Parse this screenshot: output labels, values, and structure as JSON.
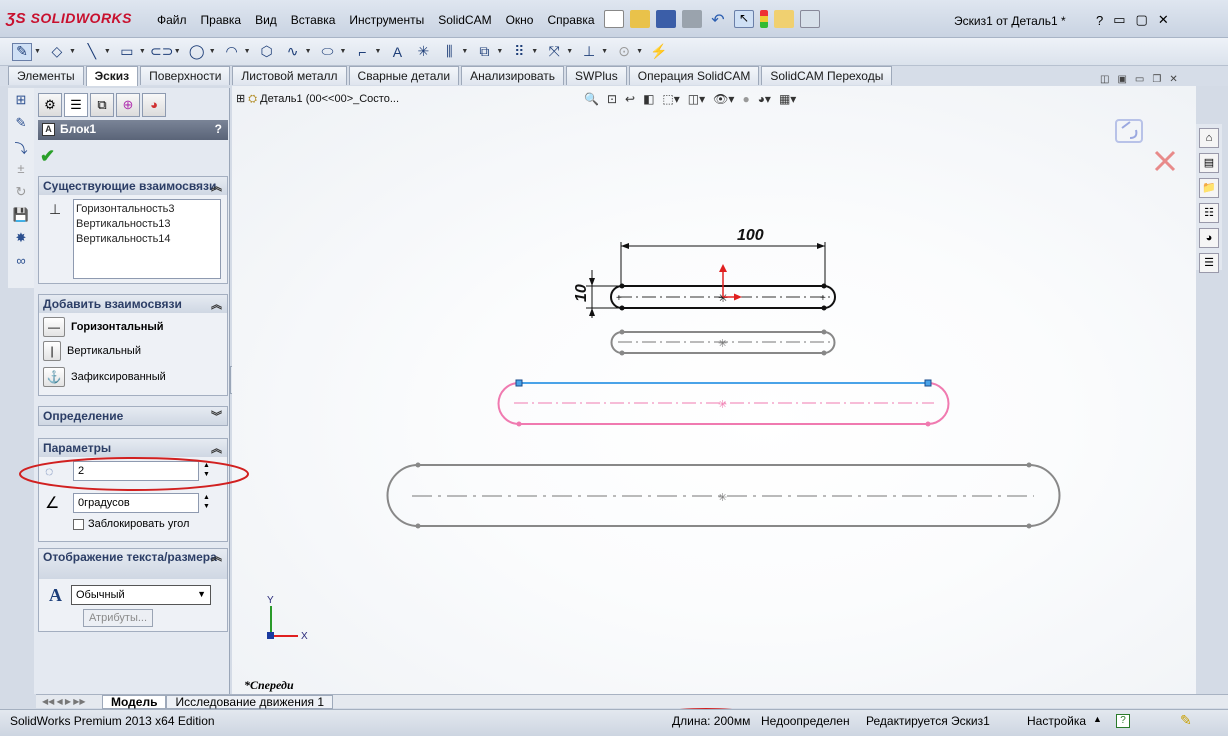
{
  "app": {
    "logo": "SOLIDWORKS",
    "document_title": "Эскиз1 от Деталь1 *"
  },
  "menu": [
    "Файл",
    "Правка",
    "Вид",
    "Вставка",
    "Инструменты",
    "SolidCAM",
    "Окно",
    "Справка"
  ],
  "command_tabs": [
    {
      "label": "Элементы",
      "active": false
    },
    {
      "label": "Эскиз",
      "active": true
    },
    {
      "label": "Поверхности",
      "active": false
    },
    {
      "label": "Листовой металл",
      "active": false
    },
    {
      "label": "Сварные детали",
      "active": false
    },
    {
      "label": "Анализировать",
      "active": false
    },
    {
      "label": "SWPlus",
      "active": false
    },
    {
      "label": "Операция  SolidCAM",
      "active": false
    },
    {
      "label": "SolidCAM Переходы",
      "active": false
    }
  ],
  "property_manager": {
    "title": "Блок1",
    "help": "?",
    "existing_relations": {
      "header": "Существующие взаимосвязи",
      "items": [
        "Горизонтальность3",
        "Вертикальность13",
        "Вертикальность14"
      ]
    },
    "add_relations": {
      "header": "Добавить взаимосвязи",
      "items": [
        {
          "label": "Горизонтальный",
          "bold": true
        },
        {
          "label": "Вертикальный",
          "bold": false
        },
        {
          "label": "Зафиксированный",
          "bold": false
        }
      ]
    },
    "definition": {
      "header": "Определение"
    },
    "parameters": {
      "header": "Параметры",
      "scale_value": "2",
      "angle_value": "0градусов",
      "lock_angle_label": "Заблокировать угол"
    },
    "text_display": {
      "header": "Отображение текста/размера",
      "font_style": "Обычный",
      "attributes_button": "Атрибуты..."
    }
  },
  "feature_tree": {
    "item": "Деталь1  (00<<00>_Состо..."
  },
  "sketch": {
    "dimension_length": "100",
    "dimension_height": "10",
    "view_label": "*Спереди",
    "axis_x": "X",
    "axis_y": "Y"
  },
  "bottom_tabs": [
    {
      "label": "Модель",
      "active": true
    },
    {
      "label": "Исследование движения 1",
      "active": false
    }
  ],
  "status": {
    "edition": "SolidWorks Premium 2013 x64 Edition",
    "length": "Длина: 200мм",
    "definition": "Недоопределен",
    "editing": "Редактируется Эскиз1",
    "settings": "Настройка"
  },
  "colors": {
    "selected_blue": "#4aa3e8",
    "selected_pink": "#f07ab0",
    "highlight_red": "#d12020",
    "origin_red": "#e02020"
  }
}
